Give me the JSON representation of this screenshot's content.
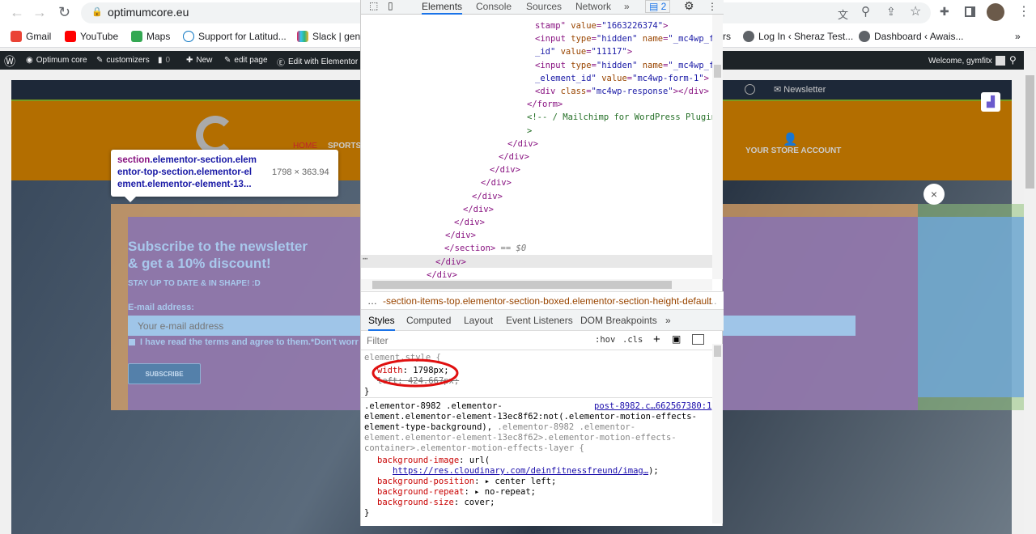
{
  "browser": {
    "url": "optimumcore.eu",
    "bookmarks": [
      "Gmail",
      "YouTube",
      "Maps",
      "Support for Latitud...",
      "Slack | gene",
      "rs",
      "Log In ‹ Sheraz Test...",
      "Dashboard ‹ Awais..."
    ],
    "more": "»"
  },
  "wpbar": {
    "items": [
      "Optimum core",
      "customizers",
      "0",
      "New",
      "edit page",
      "Edit with Elementor"
    ],
    "welcome": "Welcome, gymfitx"
  },
  "site": {
    "newsletter": "Newsletter",
    "nav": [
      "HOME",
      "SPORTS"
    ],
    "account": "YOUR STORE ACCOUNT",
    "headline1": "Subscribe to the newsletter",
    "headline2": "& get a 10% discount!",
    "subhead": "STAY UP TO DATE & IN SHAPE! :D",
    "email_label": "E-mail address:",
    "email_placeholder": "Your e-mail address",
    "terms": "I have read the terms and agree to them.*Don't worry,",
    "subscribe": "SUBSCRIBE",
    "close": "×"
  },
  "tooltip": {
    "tag": "section",
    "classes": ".elementor-section.elem",
    "classes2": "entor-top-section.elementor-el",
    "classes3": "ement.elementor-element-13...",
    "size": "1798 × 363.94"
  },
  "devtools": {
    "tabs": [
      "Elements",
      "Console",
      "Sources",
      "Network"
    ],
    "more": "»",
    "issues": "2",
    "dom_lines": [
      [
        [
          "tag",
          "stamp\" "
        ],
        [
          "attr",
          "value"
        ],
        [
          "tag",
          "="
        ],
        [
          "val",
          "\"1663226374\""
        ],
        [
          "tag",
          ">"
        ]
      ],
      [
        [
          "tag",
          "<input "
        ],
        [
          "attr",
          "type"
        ],
        [
          "tag",
          "="
        ],
        [
          "val",
          "\"hidden\" "
        ],
        [
          "attr",
          "name"
        ],
        [
          "tag",
          "="
        ],
        [
          "val",
          "\"_mc4wp_f"
        ]
      ],
      [
        [
          "val",
          "_id\" "
        ],
        [
          "attr",
          "value"
        ],
        [
          "tag",
          "="
        ],
        [
          "val",
          "\"11117\""
        ],
        [
          "tag",
          ">"
        ]
      ],
      [
        [
          "tag",
          "<input "
        ],
        [
          "attr",
          "type"
        ],
        [
          "tag",
          "="
        ],
        [
          "val",
          "\"hidden\" "
        ],
        [
          "attr",
          "name"
        ],
        [
          "tag",
          "="
        ],
        [
          "val",
          "\"_mc4wp_f"
        ]
      ],
      [
        [
          "val",
          "_element_id\" "
        ],
        [
          "attr",
          "value"
        ],
        [
          "tag",
          "="
        ],
        [
          "val",
          "\"mc4wp-form-1\""
        ],
        [
          "tag",
          ">"
        ]
      ],
      [
        [
          "tag",
          "<div "
        ],
        [
          "attr",
          "class"
        ],
        [
          "tag",
          "="
        ],
        [
          "val",
          "\"mc4wp-response\""
        ],
        [
          "tag",
          "></div>"
        ]
      ],
      [
        [
          "tag",
          "</form>"
        ]
      ],
      [
        [
          "cmt",
          "<!-- / Mailchimp for WordPress Plugin"
        ]
      ],
      [
        [
          "cmt",
          ">"
        ]
      ],
      [
        [
          "tag",
          "</div>"
        ]
      ],
      [
        [
          "tag",
          "</div>"
        ]
      ],
      [
        [
          "tag",
          "</div>"
        ]
      ],
      [
        [
          "tag",
          "</div>"
        ]
      ],
      [
        [
          "tag",
          "</div>"
        ]
      ],
      [
        [
          "tag",
          "</div>"
        ]
      ],
      [
        [
          "tag",
          "</div>"
        ]
      ],
      [
        [
          "tag",
          "</div>"
        ]
      ],
      [
        [
          "tag",
          "</section>"
        ],
        [
          "dim",
          " == $0"
        ]
      ],
      [
        [
          "tag",
          "</div>"
        ]
      ],
      [
        [
          "tag",
          "</div>"
        ]
      ]
    ],
    "breadcrumb": "-section-items-top.elementor-section-boxed.elementor-section-height-default",
    "style_tabs": [
      "Styles",
      "Computed",
      "Layout",
      "Event Listeners",
      "DOM Breakpoints"
    ],
    "filter_placeholder": "Filter",
    "hov": ":hov",
    "cls": ".cls",
    "element_style": "element.style {",
    "width_prop": "width",
    "width_val": "1798px;",
    "left_prop": "left",
    "left_val": "424.667px;",
    "rule_selector1": ".elementor-8982 .elementor-",
    "rule_source": "post-8982.c…662567380:1",
    "rule_selector2": "element.elementor-element-13ec8f62:not(.elementor-motion-effects-",
    "rule_selector3": "element-type-background),",
    "rule_selector3b": ".elementor-8982 .elementor-",
    "rule_selector4": "element.elementor-element-13ec8f62>.elementor-motion-effects-",
    "rule_selector5": "container>.elementor-motion-effects-layer {",
    "bg_image": "background-image",
    "bg_image_val": "url(",
    "bg_url": "https://res.cloudinary.com/deinfitnessfreund/imag…",
    "bg_url_end": ");",
    "bg_pos": "background-position",
    "bg_pos_val": "center left;",
    "bg_rep": "background-repeat",
    "bg_rep_val": "no-repeat;",
    "bg_size": "background-size",
    "bg_size_val": "cover;",
    "close_brace": "}"
  }
}
